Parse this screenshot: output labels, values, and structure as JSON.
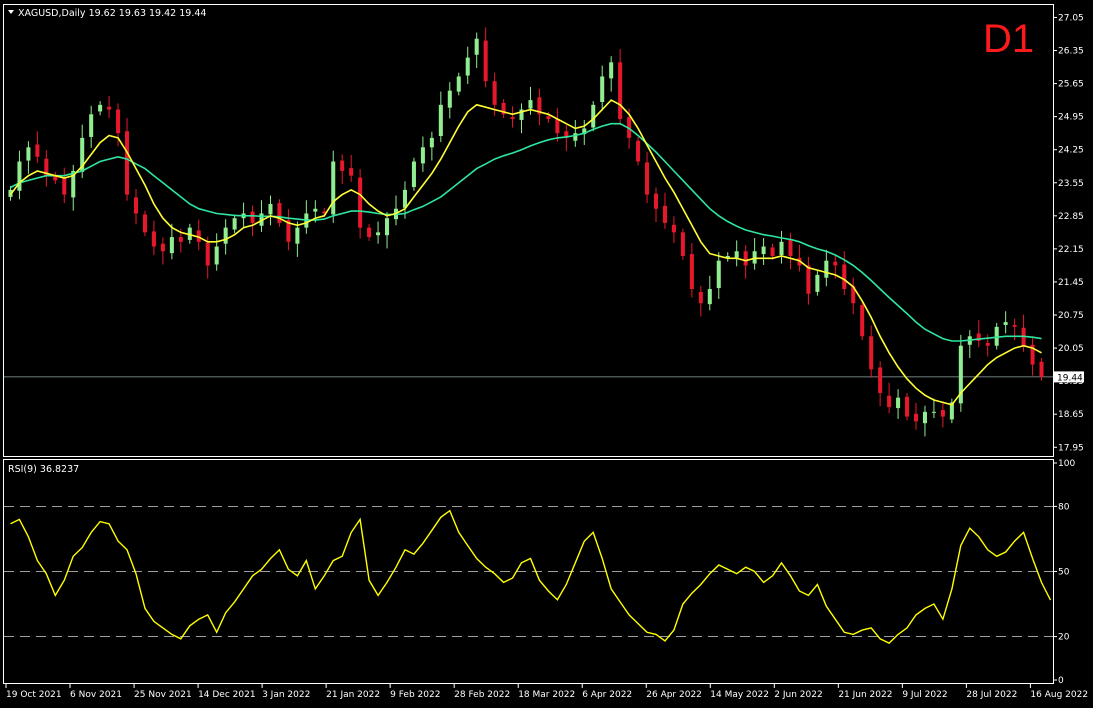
{
  "colors": {
    "background": "#000000",
    "frame": "#ffffff",
    "bull_candle": "#90ee90",
    "bear_candle": "#e8182c",
    "ma_fast": "#ffff33",
    "ma_slow": "#2ee6a0",
    "rsi_line": "#ffff00",
    "timeframe_label": "#ff1a1a"
  },
  "header": {
    "symbol_line": "XAGUSD,Daily  19.62 19.63 19.42 19.44",
    "timeframe_label": "D1",
    "dropdown_icon": "triangle-down-icon"
  },
  "price_panel": {
    "current_price_label": "19.44",
    "current_price": 19.44
  },
  "rsi_panel": {
    "title": "RSI(9) 36.8237",
    "levels": [
      20,
      50,
      80
    ]
  },
  "chart_data": [
    {
      "type": "line",
      "y_ticks": [
        "27.05",
        "26.35",
        "25.65",
        "24.95",
        "24.25",
        "23.55",
        "22.85",
        "22.15",
        "21.45",
        "20.75",
        "20.05",
        "19.35",
        "18.65",
        "17.95"
      ],
      "ylim": [
        17.85,
        27.25
      ],
      "x_tick_labels": [
        "19 Oct 2021",
        "6 Nov 2021",
        "25 Nov 2021",
        "14 Dec 2021",
        "3 Jan 2022",
        "21 Jan 2022",
        "9 Feb 2022",
        "28 Feb 2022",
        "18 Mar 2022",
        "6 Apr 2022",
        "26 Apr 2022",
        "14 May 2022",
        "2 Jun 2022",
        "21 Jun 2022",
        "9 Jul 2022",
        "28 Jul 2022",
        "16 Aug 2022"
      ],
      "series": [
        {
          "kind": "close",
          "values": [
            23.4,
            24.0,
            24.3,
            24.1,
            23.7,
            23.6,
            23.3,
            23.8,
            24.5,
            25.0,
            25.2,
            25.1,
            24.6,
            23.3,
            22.9,
            22.5,
            22.2,
            22.1,
            22.4,
            22.3,
            22.6,
            22.3,
            21.8,
            22.2,
            22.6,
            22.8,
            22.9,
            22.7,
            22.9,
            23.1,
            22.7,
            22.3,
            22.6,
            22.9,
            23.0,
            22.9,
            24.0,
            23.8,
            23.7,
            22.6,
            22.4,
            22.5,
            22.8,
            23.0,
            23.4,
            24.0,
            24.3,
            24.5,
            25.2,
            25.5,
            25.8,
            26.2,
            26.6,
            25.7,
            25.2,
            25.0,
            24.9,
            25.1,
            25.3,
            25.0,
            24.9,
            24.6,
            24.5,
            24.6,
            24.7,
            25.2,
            25.8,
            26.1,
            24.9,
            24.5,
            24.0,
            23.3,
            23.0,
            22.7,
            22.5,
            22.0,
            21.3,
            21.0,
            21.3,
            21.9,
            22.0,
            22.1,
            21.8,
            22.1,
            22.2,
            22.0,
            22.3,
            22.0,
            21.8,
            21.2,
            21.6,
            21.9,
            21.8,
            21.3,
            21.0,
            20.3,
            19.6,
            19.1,
            18.8,
            19.0,
            18.6,
            18.5,
            18.7,
            18.7,
            18.6,
            18.9,
            20.1,
            20.3,
            20.2,
            20.1,
            20.5,
            20.6,
            20.5,
            20.1,
            19.7,
            19.44
          ],
          "name": ""
        },
        {
          "kind": "ma_fast",
          "values": [
            23.3,
            23.55,
            23.7,
            23.8,
            23.75,
            23.7,
            23.65,
            23.7,
            23.9,
            24.15,
            24.4,
            24.55,
            24.5,
            24.2,
            23.85,
            23.5,
            23.1,
            22.8,
            22.6,
            22.5,
            22.45,
            22.4,
            22.3,
            22.3,
            22.35,
            22.45,
            22.6,
            22.65,
            22.75,
            22.85,
            22.8,
            22.7,
            22.65,
            22.7,
            22.8,
            22.85,
            23.15,
            23.3,
            23.4,
            23.3,
            23.1,
            22.95,
            22.85,
            22.9,
            23.0,
            23.25,
            23.5,
            23.75,
            24.05,
            24.4,
            24.75,
            25.05,
            25.2,
            25.15,
            25.1,
            25.05,
            25.0,
            25.05,
            25.1,
            25.05,
            25.0,
            24.9,
            24.8,
            24.7,
            24.75,
            24.9,
            25.1,
            25.3,
            25.2,
            25.0,
            24.7,
            24.35,
            24.0,
            23.65,
            23.35,
            23.0,
            22.65,
            22.3,
            22.05,
            22.0,
            21.95,
            21.95,
            21.9,
            21.95,
            21.95,
            21.95,
            22.0,
            21.95,
            21.9,
            21.75,
            21.7,
            21.65,
            21.6,
            21.5,
            21.35,
            21.05,
            20.7,
            20.3,
            19.95,
            19.65,
            19.4,
            19.2,
            19.05,
            18.95,
            18.9,
            18.85,
            19.1,
            19.3,
            19.5,
            19.7,
            19.85,
            19.95,
            20.05,
            20.1,
            20.05,
            19.95
          ],
          "name": ""
        },
        {
          "kind": "ma_slow",
          "values": [
            23.45,
            23.55,
            23.6,
            23.65,
            23.7,
            23.7,
            23.7,
            23.75,
            23.8,
            23.9,
            24.0,
            24.05,
            24.1,
            24.05,
            23.95,
            23.85,
            23.7,
            23.55,
            23.4,
            23.25,
            23.1,
            23.0,
            22.95,
            22.9,
            22.88,
            22.86,
            22.85,
            22.85,
            22.84,
            22.84,
            22.83,
            22.8,
            22.78,
            22.76,
            22.76,
            22.78,
            22.85,
            22.9,
            22.95,
            22.95,
            22.93,
            22.9,
            22.88,
            22.88,
            22.9,
            22.98,
            23.05,
            23.15,
            23.25,
            23.4,
            23.55,
            23.7,
            23.85,
            23.95,
            24.05,
            24.12,
            24.18,
            24.25,
            24.33,
            24.4,
            24.46,
            24.5,
            24.52,
            24.55,
            24.6,
            24.68,
            24.75,
            24.8,
            24.8,
            24.7,
            24.55,
            24.38,
            24.2,
            24.0,
            23.8,
            23.6,
            23.4,
            23.2,
            23.0,
            22.85,
            22.73,
            22.63,
            22.55,
            22.5,
            22.45,
            22.42,
            22.38,
            22.35,
            22.3,
            22.22,
            22.15,
            22.1,
            22.02,
            21.92,
            21.8,
            21.65,
            21.48,
            21.3,
            21.12,
            20.95,
            20.78,
            20.6,
            20.45,
            20.35,
            20.25,
            20.2,
            20.2,
            20.22,
            20.24,
            20.26,
            20.28,
            20.3,
            20.3,
            20.3,
            20.28,
            20.25
          ],
          "name": ""
        }
      ]
    },
    {
      "type": "line",
      "ylim": [
        0,
        100
      ],
      "y_ticks": [
        "100",
        "80",
        "50",
        "20",
        "0"
      ],
      "series": [
        {
          "kind": "rsi",
          "values": [
            72,
            74,
            66,
            55,
            49,
            39,
            46,
            57,
            61,
            68,
            73,
            72,
            64,
            60,
            49,
            33,
            27,
            24,
            21,
            19,
            25,
            28,
            30,
            22,
            31,
            36,
            42,
            48,
            51,
            56,
            60,
            51,
            48,
            55,
            42,
            48,
            55,
            57,
            68,
            74,
            46,
            39,
            45,
            52,
            60,
            58,
            63,
            69,
            75,
            78,
            68,
            62,
            56,
            52,
            49,
            45,
            47,
            54,
            56,
            46,
            41,
            37,
            44,
            54,
            64,
            68,
            56,
            42,
            36,
            30,
            26,
            22,
            21,
            18,
            23,
            35,
            40,
            44,
            49,
            53,
            51,
            49,
            52,
            50,
            45,
            48,
            54,
            48,
            41,
            39,
            44,
            34,
            28,
            22,
            21,
            23,
            24,
            19,
            17,
            21,
            24,
            30,
            33,
            35,
            28,
            42,
            62,
            70,
            66,
            60,
            57,
            59,
            64,
            68,
            56,
            45,
            36.8
          ],
          "name": ""
        }
      ]
    }
  ]
}
